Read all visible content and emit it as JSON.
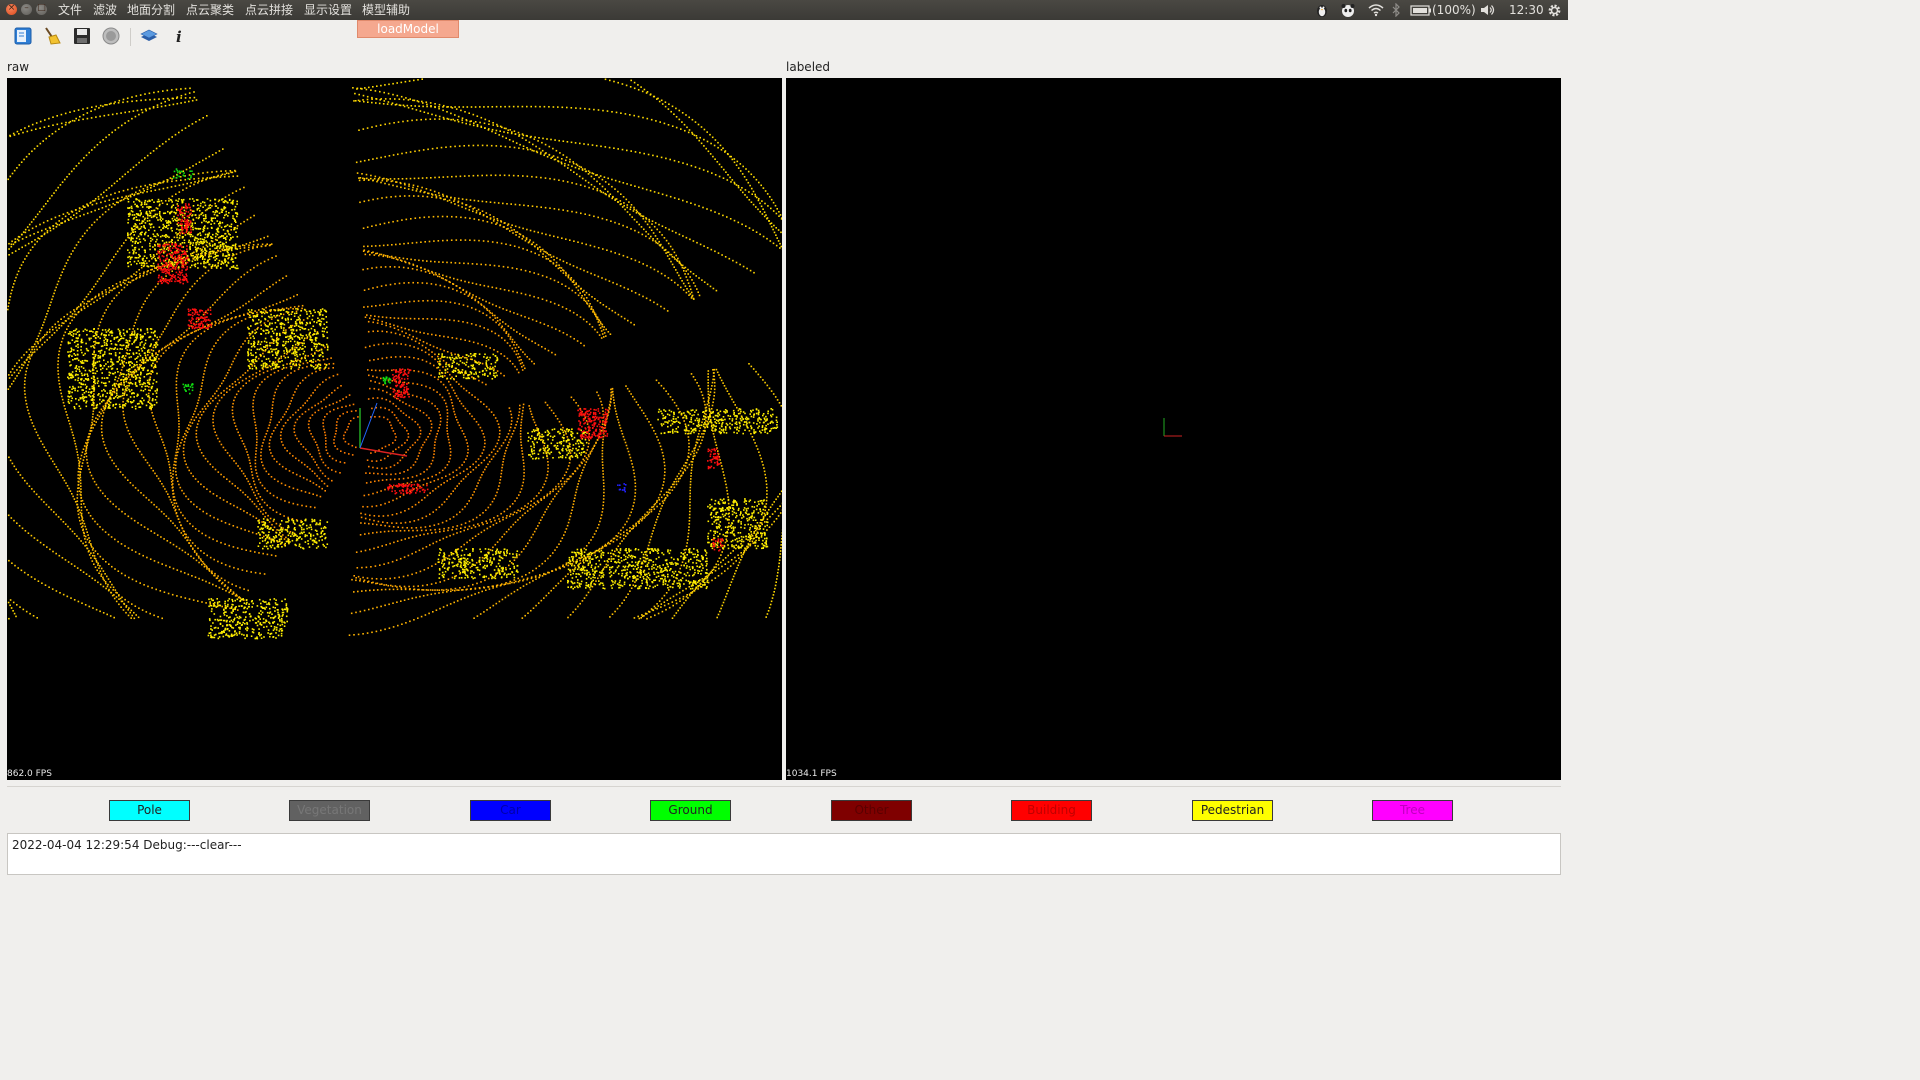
{
  "window": {
    "close_glyph": "×",
    "min_glyph": "–",
    "max_glyph": "□"
  },
  "menu": [
    {
      "label": "文件"
    },
    {
      "label": "滤波"
    },
    {
      "label": "地面分割"
    },
    {
      "label": "点云聚类"
    },
    {
      "label": "点云拼接"
    },
    {
      "label": "显示设置"
    },
    {
      "label": "模型辅助"
    }
  ],
  "dropdown": {
    "items": [
      {
        "label": "loadModel"
      }
    ]
  },
  "tray": {
    "battery": "(100%)",
    "clock": "12:30"
  },
  "toolbar": {
    "icons": [
      "open-file-icon",
      "clean-broom-icon",
      "save-disk-icon",
      "record-circle-icon",
      "layers-icon",
      "info-icon"
    ]
  },
  "panes": {
    "raw": {
      "title": "raw",
      "fps": "862.0 FPS"
    },
    "labeled": {
      "title": "labeled",
      "fps": "1034.1 FPS"
    }
  },
  "classes": [
    {
      "label": "Pole",
      "color": "#00ffff"
    },
    {
      "label": "Vegetation",
      "color": "#616161"
    },
    {
      "label": "Car",
      "color": "#0000ff"
    },
    {
      "label": "Ground",
      "color": "#00ff00"
    },
    {
      "label": "Other",
      "color": "#7f0000"
    },
    {
      "label": "Building",
      "color": "#ff0000"
    },
    {
      "label": "Pedestrian",
      "color": "#ffff00"
    },
    {
      "label": "Tree",
      "color": "#ff00ff"
    }
  ],
  "log": {
    "lines": [
      "2022-04-04 12:29:54 Debug:---clear---"
    ]
  }
}
